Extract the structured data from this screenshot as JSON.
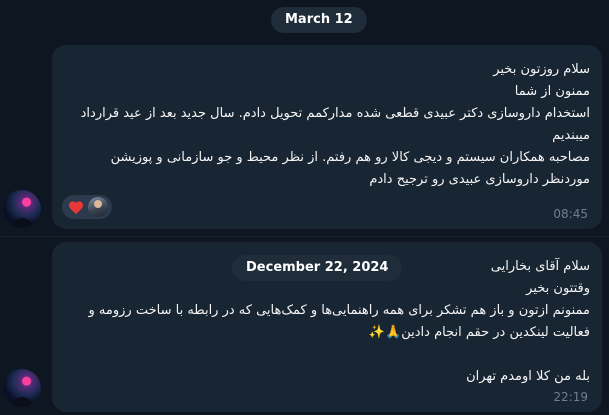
{
  "chat": {
    "date_separator_1": "March 12",
    "date_separator_2": "December 22, 2024",
    "messages": [
      {
        "text": "سلام روزتون بخیر\nممنون از شما\nاستخدام داروسازی دکتر عبیدی قطعی شده  مدارکمم تحویل دادم. سال جدید بعد از عید قرارداد میبندیم\nمصاحبه همکاران سیستم و دیجی کالا رو هم رفتم. از نظر محیط و جو سازمانی و پوزیشن موردنظر داروسازی عبیدی رو ترجیح دادم",
        "time": "08:45",
        "reactions": [
          "heart",
          "user-avatar"
        ]
      },
      {
        "text": "سلام آقای بخارایی\nوقتتون بخیر\nممنونم ازتون و باز هم تشکر برای همه راهنمایی‌ها و کمک‌هایی که در رابطه با ساخت رزومه و فعالیت لینکدین در حقم انجام دادین🙏✨\n\nبله من کلا اومدم تهران",
        "time": "22:19"
      }
    ]
  },
  "colors": {
    "background": "#0e1621",
    "bubble": "#182533",
    "pill": "#1f2c3a",
    "time": "#6d7f8f",
    "heart": "#e53935"
  }
}
